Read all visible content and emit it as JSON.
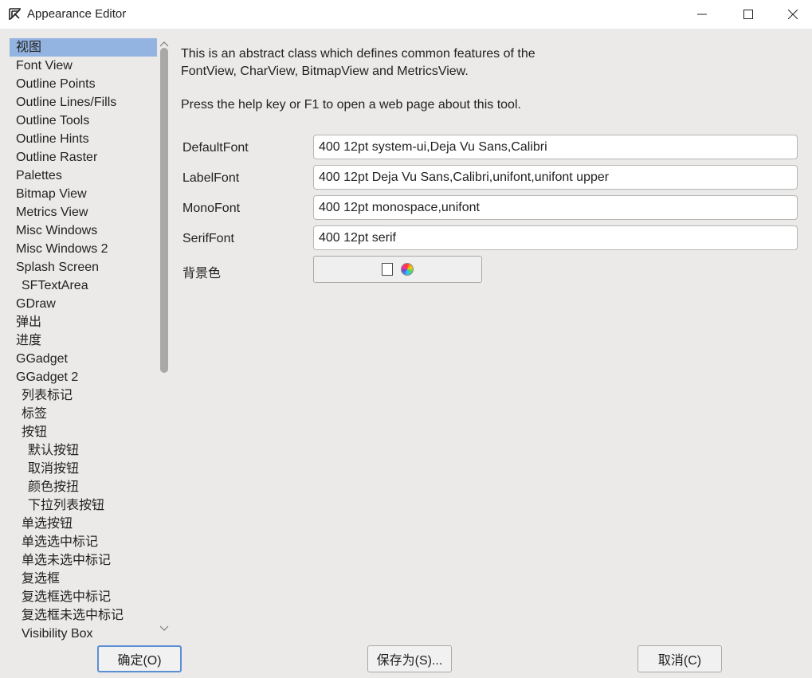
{
  "window": {
    "title": "Appearance Editor",
    "icon": "fontforge-app-icon",
    "controls": {
      "minimize": "minimize-icon",
      "maximize": "maximize-icon",
      "close": "close-icon"
    }
  },
  "sidebar": {
    "selected_index": 0,
    "items": [
      {
        "label": "视图",
        "indent": 0
      },
      {
        "label": "Font View",
        "indent": 0
      },
      {
        "label": "Outline Points",
        "indent": 0
      },
      {
        "label": "Outline Lines/Fills",
        "indent": 0
      },
      {
        "label": "Outline Tools",
        "indent": 0
      },
      {
        "label": "Outline Hints",
        "indent": 0
      },
      {
        "label": "Outline Raster",
        "indent": 0
      },
      {
        "label": "Palettes",
        "indent": 0
      },
      {
        "label": "Bitmap View",
        "indent": 0
      },
      {
        "label": "Metrics View",
        "indent": 0
      },
      {
        "label": "Misc Windows",
        "indent": 0
      },
      {
        "label": "Misc Windows 2",
        "indent": 0
      },
      {
        "label": "Splash Screen",
        "indent": 0
      },
      {
        "label": "SFTextArea",
        "indent": 1
      },
      {
        "label": "GDraw",
        "indent": 0
      },
      {
        "label": "弹出",
        "indent": 0
      },
      {
        "label": "进度",
        "indent": 0
      },
      {
        "label": "GGadget",
        "indent": 0
      },
      {
        "label": "GGadget 2",
        "indent": 0
      },
      {
        "label": "列表标记",
        "indent": 1
      },
      {
        "label": "标签",
        "indent": 1
      },
      {
        "label": "按钮",
        "indent": 1
      },
      {
        "label": "默认按钮",
        "indent": 2
      },
      {
        "label": "取消按钮",
        "indent": 2
      },
      {
        "label": "颜色按扭",
        "indent": 2
      },
      {
        "label": "下拉列表按钮",
        "indent": 2
      },
      {
        "label": "单选按钮",
        "indent": 1
      },
      {
        "label": "单选选中标记",
        "indent": 1
      },
      {
        "label": "单选未选中标记",
        "indent": 1
      },
      {
        "label": "复选框",
        "indent": 1
      },
      {
        "label": "复选框选中标记",
        "indent": 1
      },
      {
        "label": "复选框未选中标记",
        "indent": 1
      },
      {
        "label": "Visibility Box",
        "indent": 1
      }
    ]
  },
  "content": {
    "description_line1": "This is an abstract class which defines common features of the",
    "description_line2": "FontView, CharView, BitmapView and MetricsView.",
    "help_text": "Press the help key or F1 to open a web page about this tool.",
    "properties": [
      {
        "label": "DefaultFont",
        "value": "400 12pt system-ui,Deja Vu Sans,Calibri"
      },
      {
        "label": "LabelFont",
        "value": "400 12pt Deja Vu Sans,Calibri,unifont,unifont upper"
      },
      {
        "label": "MonoFont",
        "value": "400 12pt monospace,unifont"
      },
      {
        "label": "SerifFont",
        "value": "400 12pt serif"
      }
    ],
    "background_label": "背景色",
    "background_color": "#ffffff"
  },
  "buttons": {
    "ok": "确定(O)",
    "save_as": "保存为(S)...",
    "cancel": "取消(C)"
  },
  "colors": {
    "selection": "#93b3e1",
    "panel_bg": "#eceae8",
    "default_button_border": "#5a8fd6"
  }
}
